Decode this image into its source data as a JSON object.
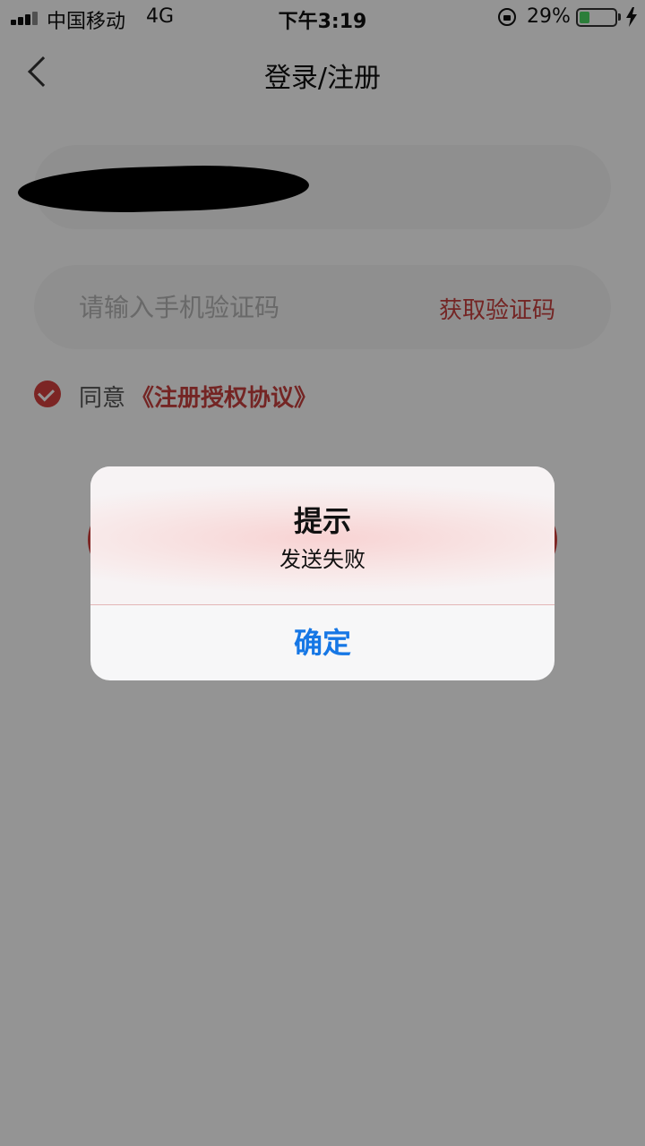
{
  "status_bar": {
    "carrier": "中国移动",
    "network": "4G",
    "time": "下午3:19",
    "battery_percent": "29%",
    "battery_level": 0.29
  },
  "nav": {
    "title": "登录/注册",
    "back_icon": "chevron-left-icon"
  },
  "form": {
    "phone_value": "",
    "code_placeholder": "请输入手机验证码",
    "get_code_label": "获取验证码",
    "agree_label": "同意",
    "agreement_link": "《注册授权协议》"
  },
  "alert": {
    "title": "提示",
    "message": "发送失败",
    "confirm_label": "确定"
  },
  "colors": {
    "accent_red": "#d8433f",
    "link_blue": "#1677e5",
    "battery_green": "#4cd964"
  }
}
